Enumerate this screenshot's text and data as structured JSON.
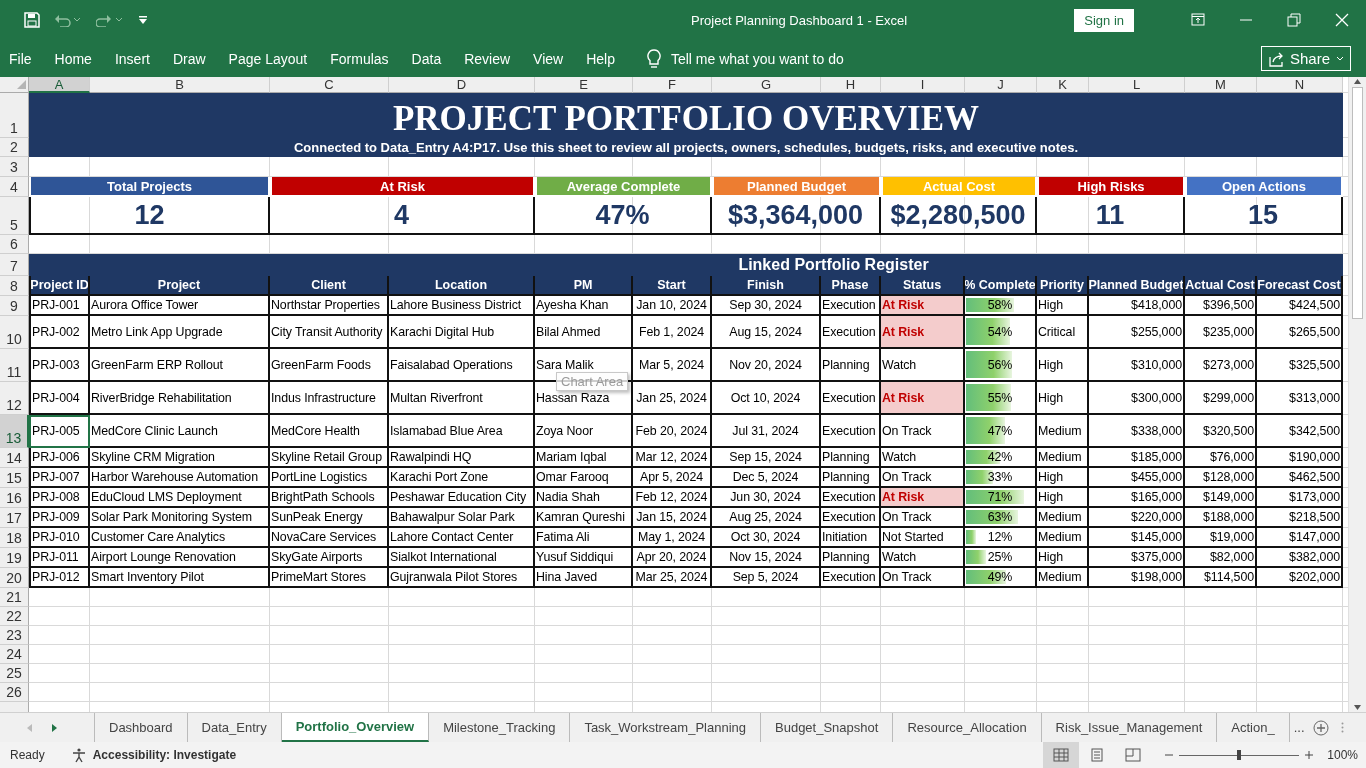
{
  "window": {
    "title": "Project Planning Dashboard 1  -  Excel",
    "sign_in": "Sign in"
  },
  "menu": [
    {
      "label": "File"
    },
    {
      "label": "Home"
    },
    {
      "label": "Insert"
    },
    {
      "label": "Draw"
    },
    {
      "label": "Page Layout"
    },
    {
      "label": "Formulas"
    },
    {
      "label": "Data"
    },
    {
      "label": "Review"
    },
    {
      "label": "View"
    },
    {
      "label": "Help"
    }
  ],
  "tell_me": "Tell me what you want to do",
  "share": "Share",
  "column_headers": [
    {
      "label": "A",
      "selected": true
    },
    {
      "label": "B",
      "selected": false
    },
    {
      "label": "C",
      "selected": false
    },
    {
      "label": "D",
      "selected": false
    },
    {
      "label": "E",
      "selected": false
    },
    {
      "label": "F",
      "selected": false
    },
    {
      "label": "G",
      "selected": false
    },
    {
      "label": "H",
      "selected": false
    },
    {
      "label": "I",
      "selected": false
    },
    {
      "label": "J",
      "selected": false
    },
    {
      "label": "K",
      "selected": false
    },
    {
      "label": "L",
      "selected": false
    },
    {
      "label": "M",
      "selected": false
    },
    {
      "label": "N",
      "selected": false
    }
  ],
  "row_numbers": [
    {
      "label": "1",
      "selected": false
    },
    {
      "label": "2",
      "selected": false
    },
    {
      "label": "3",
      "selected": false
    },
    {
      "label": "4",
      "selected": false
    },
    {
      "label": "5",
      "selected": false
    },
    {
      "label": "6",
      "selected": false
    },
    {
      "label": "7",
      "selected": false
    },
    {
      "label": "8",
      "selected": false
    },
    {
      "label": "9",
      "selected": false
    },
    {
      "label": "10",
      "selected": false
    },
    {
      "label": "11",
      "selected": false
    },
    {
      "label": "12",
      "selected": false
    },
    {
      "label": "13",
      "selected": true
    },
    {
      "label": "14",
      "selected": false
    },
    {
      "label": "15",
      "selected": false
    },
    {
      "label": "16",
      "selected": false
    },
    {
      "label": "17",
      "selected": false
    },
    {
      "label": "18",
      "selected": false
    },
    {
      "label": "19",
      "selected": false
    },
    {
      "label": "20",
      "selected": false
    },
    {
      "label": "21",
      "selected": false
    },
    {
      "label": "22",
      "selected": false
    },
    {
      "label": "23",
      "selected": false
    },
    {
      "label": "24",
      "selected": false
    },
    {
      "label": "25",
      "selected": false
    },
    {
      "label": "26",
      "selected": false
    }
  ],
  "sheet": {
    "title": "PROJECT PORTFOLIO OVERVIEW",
    "subtitle": "Connected to Data_Entry A4:P17. Use this sheet to review all projects, owners, schedules, budgets, risks, and executive notes.",
    "kpis": [
      {
        "label": "Total Projects",
        "value": "12",
        "color": "#2f5597"
      },
      {
        "label": "At Risk",
        "value": "4",
        "color": "#c00000"
      },
      {
        "label": "Average Complete",
        "value": "47%",
        "color": "#70ad47"
      },
      {
        "label": "Planned Budget",
        "value": "$3,364,000",
        "color": "#ed7d31"
      },
      {
        "label": "Actual Cost",
        "value": "$2,280,500",
        "color": "#ffc000"
      },
      {
        "label": "High Risks",
        "value": "11",
        "color": "#c00000"
      },
      {
        "label": "Open Actions",
        "value": "15",
        "color": "#4472c4"
      }
    ],
    "register_title": "Linked Portfolio Register",
    "table": {
      "columns": [
        "Project ID",
        "Project",
        "Client",
        "Location",
        "PM",
        "Start",
        "Finish",
        "Phase",
        "Status",
        "% Complete",
        "Priority",
        "Planned Budget",
        "Actual Cost",
        "Forecast Cost"
      ],
      "rows": [
        {
          "cells": [
            "PRJ-001",
            "Aurora Office Tower",
            "Northstar Properties",
            "Lahore Business District",
            "Ayesha Khan",
            "Jan 10, 2024",
            "Sep 30, 2024",
            "Execution",
            "At Risk",
            "58%",
            "High",
            "$418,000",
            "$396,500",
            "$424,500"
          ],
          "flagged": true,
          "level": 0.7
        },
        {
          "cells": [
            "PRJ-002",
            "Metro Link App Upgrade",
            "City Transit Authority",
            "Karachi Digital Hub",
            "Bilal Ahmed",
            "Feb 1, 2024",
            "Aug 15, 2024",
            "Execution",
            "At Risk",
            "54%",
            "Critical",
            "$255,000",
            "$235,000",
            "$265,500"
          ],
          "flagged": true,
          "level": 0.65
        },
        {
          "cells": [
            "PRJ-003",
            "GreenFarm ERP Rollout",
            "GreenFarm Foods",
            "Faisalabad Operations",
            "Sara Malik",
            "Mar 5, 2024",
            "Nov 20, 2024",
            "Planning",
            "Watch",
            "56%",
            "High",
            "$310,000",
            "$273,000",
            "$325,500"
          ],
          "flagged": false,
          "level": 0.68
        },
        {
          "cells": [
            "PRJ-004",
            "RiverBridge Rehabilitation",
            "Indus Infrastructure",
            "Multan Riverfront",
            "Hassan Raza",
            "Jan 25, 2024",
            "Oct 10, 2024",
            "Execution",
            "At Risk",
            "55%",
            "High",
            "$300,000",
            "$299,000",
            "$313,000"
          ],
          "flagged": true,
          "level": 0.66
        },
        {
          "cells": [
            "PRJ-005",
            "MedCore Clinic Launch",
            "MedCore Health",
            "Islamabad Blue Area",
            "Zoya Noor",
            "Feb 20, 2024",
            "Jul 31, 2024",
            "Execution",
            "On Track",
            "47%",
            "Medium",
            "$338,000",
            "$320,500",
            "$342,500"
          ],
          "flagged": false,
          "level": 0.57
        },
        {
          "cells": [
            "PRJ-006",
            "Skyline CRM Migration",
            "Skyline Retail Group",
            "Rawalpindi HQ",
            "Mariam Iqbal",
            "Mar 12, 2024",
            "Sep 15, 2024",
            "Planning",
            "Watch",
            "42%",
            "Medium",
            "$185,000",
            "$76,000",
            "$190,000"
          ],
          "flagged": false,
          "level": 0.5
        },
        {
          "cells": [
            "PRJ-007",
            "Harbor Warehouse Automation",
            "PortLine Logistics",
            "Karachi Port Zone",
            "Omar Farooq",
            "Apr 5, 2024",
            "Dec 5, 2024",
            "Planning",
            "On Track",
            "33%",
            "High",
            "$455,000",
            "$128,000",
            "$462,500"
          ],
          "flagged": false,
          "level": 0.4
        },
        {
          "cells": [
            "PRJ-008",
            "EduCloud LMS Deployment",
            "BrightPath Schools",
            "Peshawar Education City",
            "Nadia Shah",
            "Feb 12, 2024",
            "Jun 30, 2024",
            "Execution",
            "At Risk",
            "71%",
            "High",
            "$165,000",
            "$149,000",
            "$173,000"
          ],
          "flagged": true,
          "level": 0.86
        },
        {
          "cells": [
            "PRJ-009",
            "Solar Park Monitoring System",
            "SunPeak Energy",
            "Bahawalpur Solar Park",
            "Kamran Qureshi",
            "Jan 15, 2024",
            "Aug 25, 2024",
            "Execution",
            "On Track",
            "63%",
            "Medium",
            "$220,000",
            "$188,000",
            "$218,500"
          ],
          "flagged": false,
          "level": 0.76
        },
        {
          "cells": [
            "PRJ-010",
            "Customer Care Analytics",
            "NovaCare Services",
            "Lahore Contact Center",
            "Fatima Ali",
            "May 1, 2024",
            "Oct 30, 2024",
            "Initiation",
            "Not Started",
            "12%",
            "Medium",
            "$145,000",
            "$19,000",
            "$147,000"
          ],
          "flagged": false,
          "level": 0.14
        },
        {
          "cells": [
            "PRJ-011",
            "Airport Lounge Renovation",
            "SkyGate Airports",
            "Sialkot International",
            "Yusuf Siddiqui",
            "Apr 20, 2024",
            "Nov 15, 2024",
            "Planning",
            "Watch",
            "25%",
            "High",
            "$375,000",
            "$82,000",
            "$382,000"
          ],
          "flagged": false,
          "level": 0.3
        },
        {
          "cells": [
            "PRJ-012",
            "Smart Inventory Pilot",
            "PrimeMart Stores",
            "Gujranwala Pilot Stores",
            "Hina Javed",
            "Mar 25, 2024",
            "Sep 5, 2024",
            "Execution",
            "On Track",
            "49%",
            "Medium",
            "$198,000",
            "$114,500",
            "$202,000"
          ],
          "flagged": false,
          "level": 0.59
        }
      ]
    }
  },
  "tooltip": "Chart Area",
  "sheet_tabs": [
    {
      "label": "Dashboard",
      "selected": false
    },
    {
      "label": "Data_Entry",
      "selected": false
    },
    {
      "label": "Portfolio_Overview",
      "selected": true
    },
    {
      "label": "Milestone_Tracking",
      "selected": false
    },
    {
      "label": "Task_Workstream_Planning",
      "selected": false
    },
    {
      "label": "Budget_Snapshot",
      "selected": false
    },
    {
      "label": "Resource_Allocation",
      "selected": false
    },
    {
      "label": "Risk_Issue_Management",
      "selected": false
    },
    {
      "label": "Action_",
      "selected": false
    }
  ],
  "more_tabs": "...",
  "status_bar": {
    "mode": "Ready",
    "accessibility": "Accessibility: Investigate",
    "zoom": "100%",
    "zoom_slider": {
      "level": 0.5
    }
  }
}
